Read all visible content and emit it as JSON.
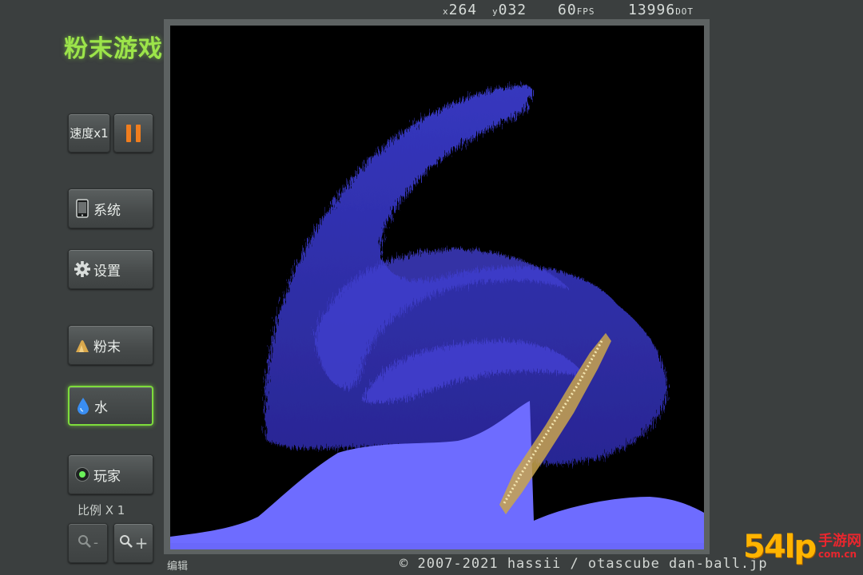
{
  "app": {
    "title": "粉末游戏"
  },
  "status": {
    "x_prefix": "x",
    "x_value": "264",
    "y_prefix": "y",
    "y_value": "032",
    "fps_value": "60",
    "fps_unit": "FPS",
    "dot_value": "13996",
    "dot_unit": "DOT"
  },
  "controls": {
    "speed_label": "速度x1",
    "system_label": "系统",
    "settings_label": "设置",
    "powder_label": "粉末",
    "water_label": "水",
    "player_label": "玩家",
    "scale_label": "比例 X 1",
    "zoom_out_label": "-",
    "zoom_in_label": "+"
  },
  "footer": {
    "edit_label": "编辑",
    "copyright": "© 2007-2021 hassii / otascube dan-ball.jp"
  },
  "watermark": {
    "number": "54",
    "suffix": "lp",
    "cn": "手游网",
    "url": "com.cn"
  },
  "colors": {
    "accent_green": "#9ce44a",
    "pause_orange": "#f07d1e",
    "water_blue": "#6e6cff",
    "water_deep": "#3c36c8",
    "sand": "#e8cc80"
  },
  "icons": {
    "system": "phone-icon",
    "settings": "gear-icon",
    "powder": "powder-pile-icon",
    "water": "water-drop-icon",
    "player": "player-dot-icon",
    "zoom": "magnifier-icon"
  }
}
